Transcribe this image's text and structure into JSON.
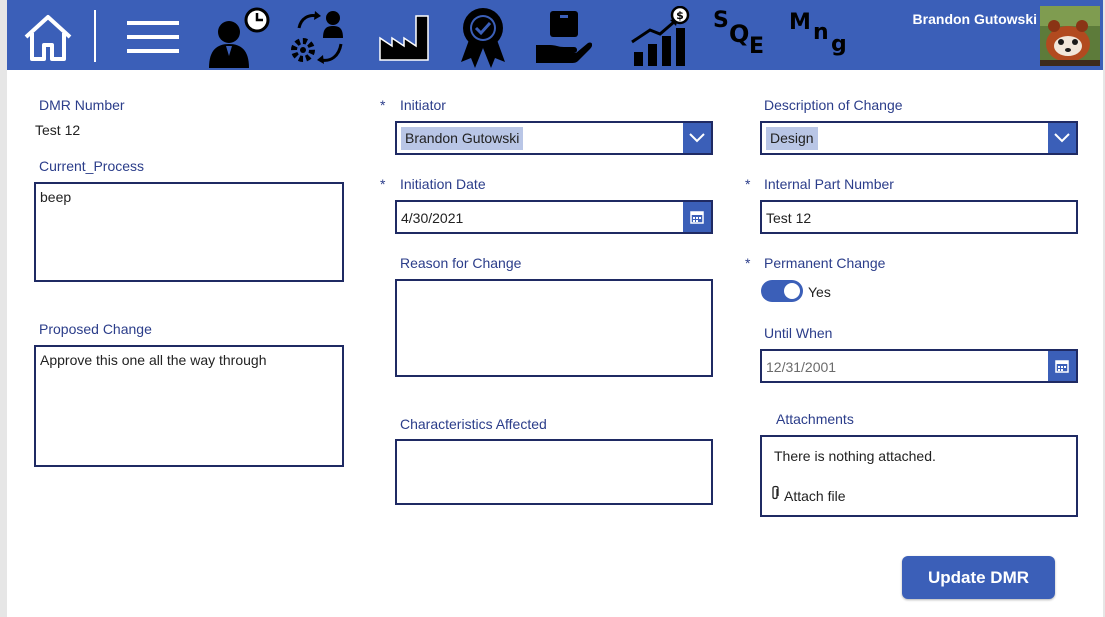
{
  "header": {
    "user_name": "Brandon Gutowski",
    "nav_icons": [
      "home-icon",
      "menu-icon",
      "user-clock-icon",
      "process-cycle-icon",
      "factory-icon",
      "award-badge-icon",
      "hand-box-icon",
      "growth-chart-icon",
      "sqe-logo",
      "mng-logo"
    ],
    "sqe_text": {
      "s": "S",
      "q": "Q",
      "e": "E"
    },
    "mng_text": {
      "m": "M",
      "n": "n",
      "g": "g"
    },
    "accent_color": "#3b5fb8"
  },
  "form": {
    "dmr_number": {
      "label": "DMR Number",
      "value": "Test 12"
    },
    "current_process": {
      "label": "Current_Process",
      "value": "beep"
    },
    "proposed_change": {
      "label": "Proposed Change",
      "value": "Approve this one all the way through"
    },
    "initiator": {
      "required": "*",
      "label": "Initiator",
      "value": "Brandon Gutowski"
    },
    "initiation_date": {
      "required": "*",
      "label": "Initiation Date",
      "value": "4/30/2021"
    },
    "reason_for_change": {
      "label": "Reason for Change",
      "value": ""
    },
    "characteristics_affected": {
      "label": "Characteristics Affected",
      "value": ""
    },
    "description_of_change": {
      "label": "Description of Change",
      "value": "Design"
    },
    "internal_part_number": {
      "required": "*",
      "label": "Internal Part Number",
      "value": "Test 12"
    },
    "permanent_change": {
      "required": "*",
      "label": "Permanent Change",
      "toggle_text": "Yes",
      "on": true
    },
    "until_when": {
      "label": "Until When",
      "value": "12/31/2001"
    },
    "attachments": {
      "label": "Attachments",
      "empty_text": "There is nothing attached.",
      "attach_label": "Attach file"
    },
    "update_button": "Update DMR"
  }
}
